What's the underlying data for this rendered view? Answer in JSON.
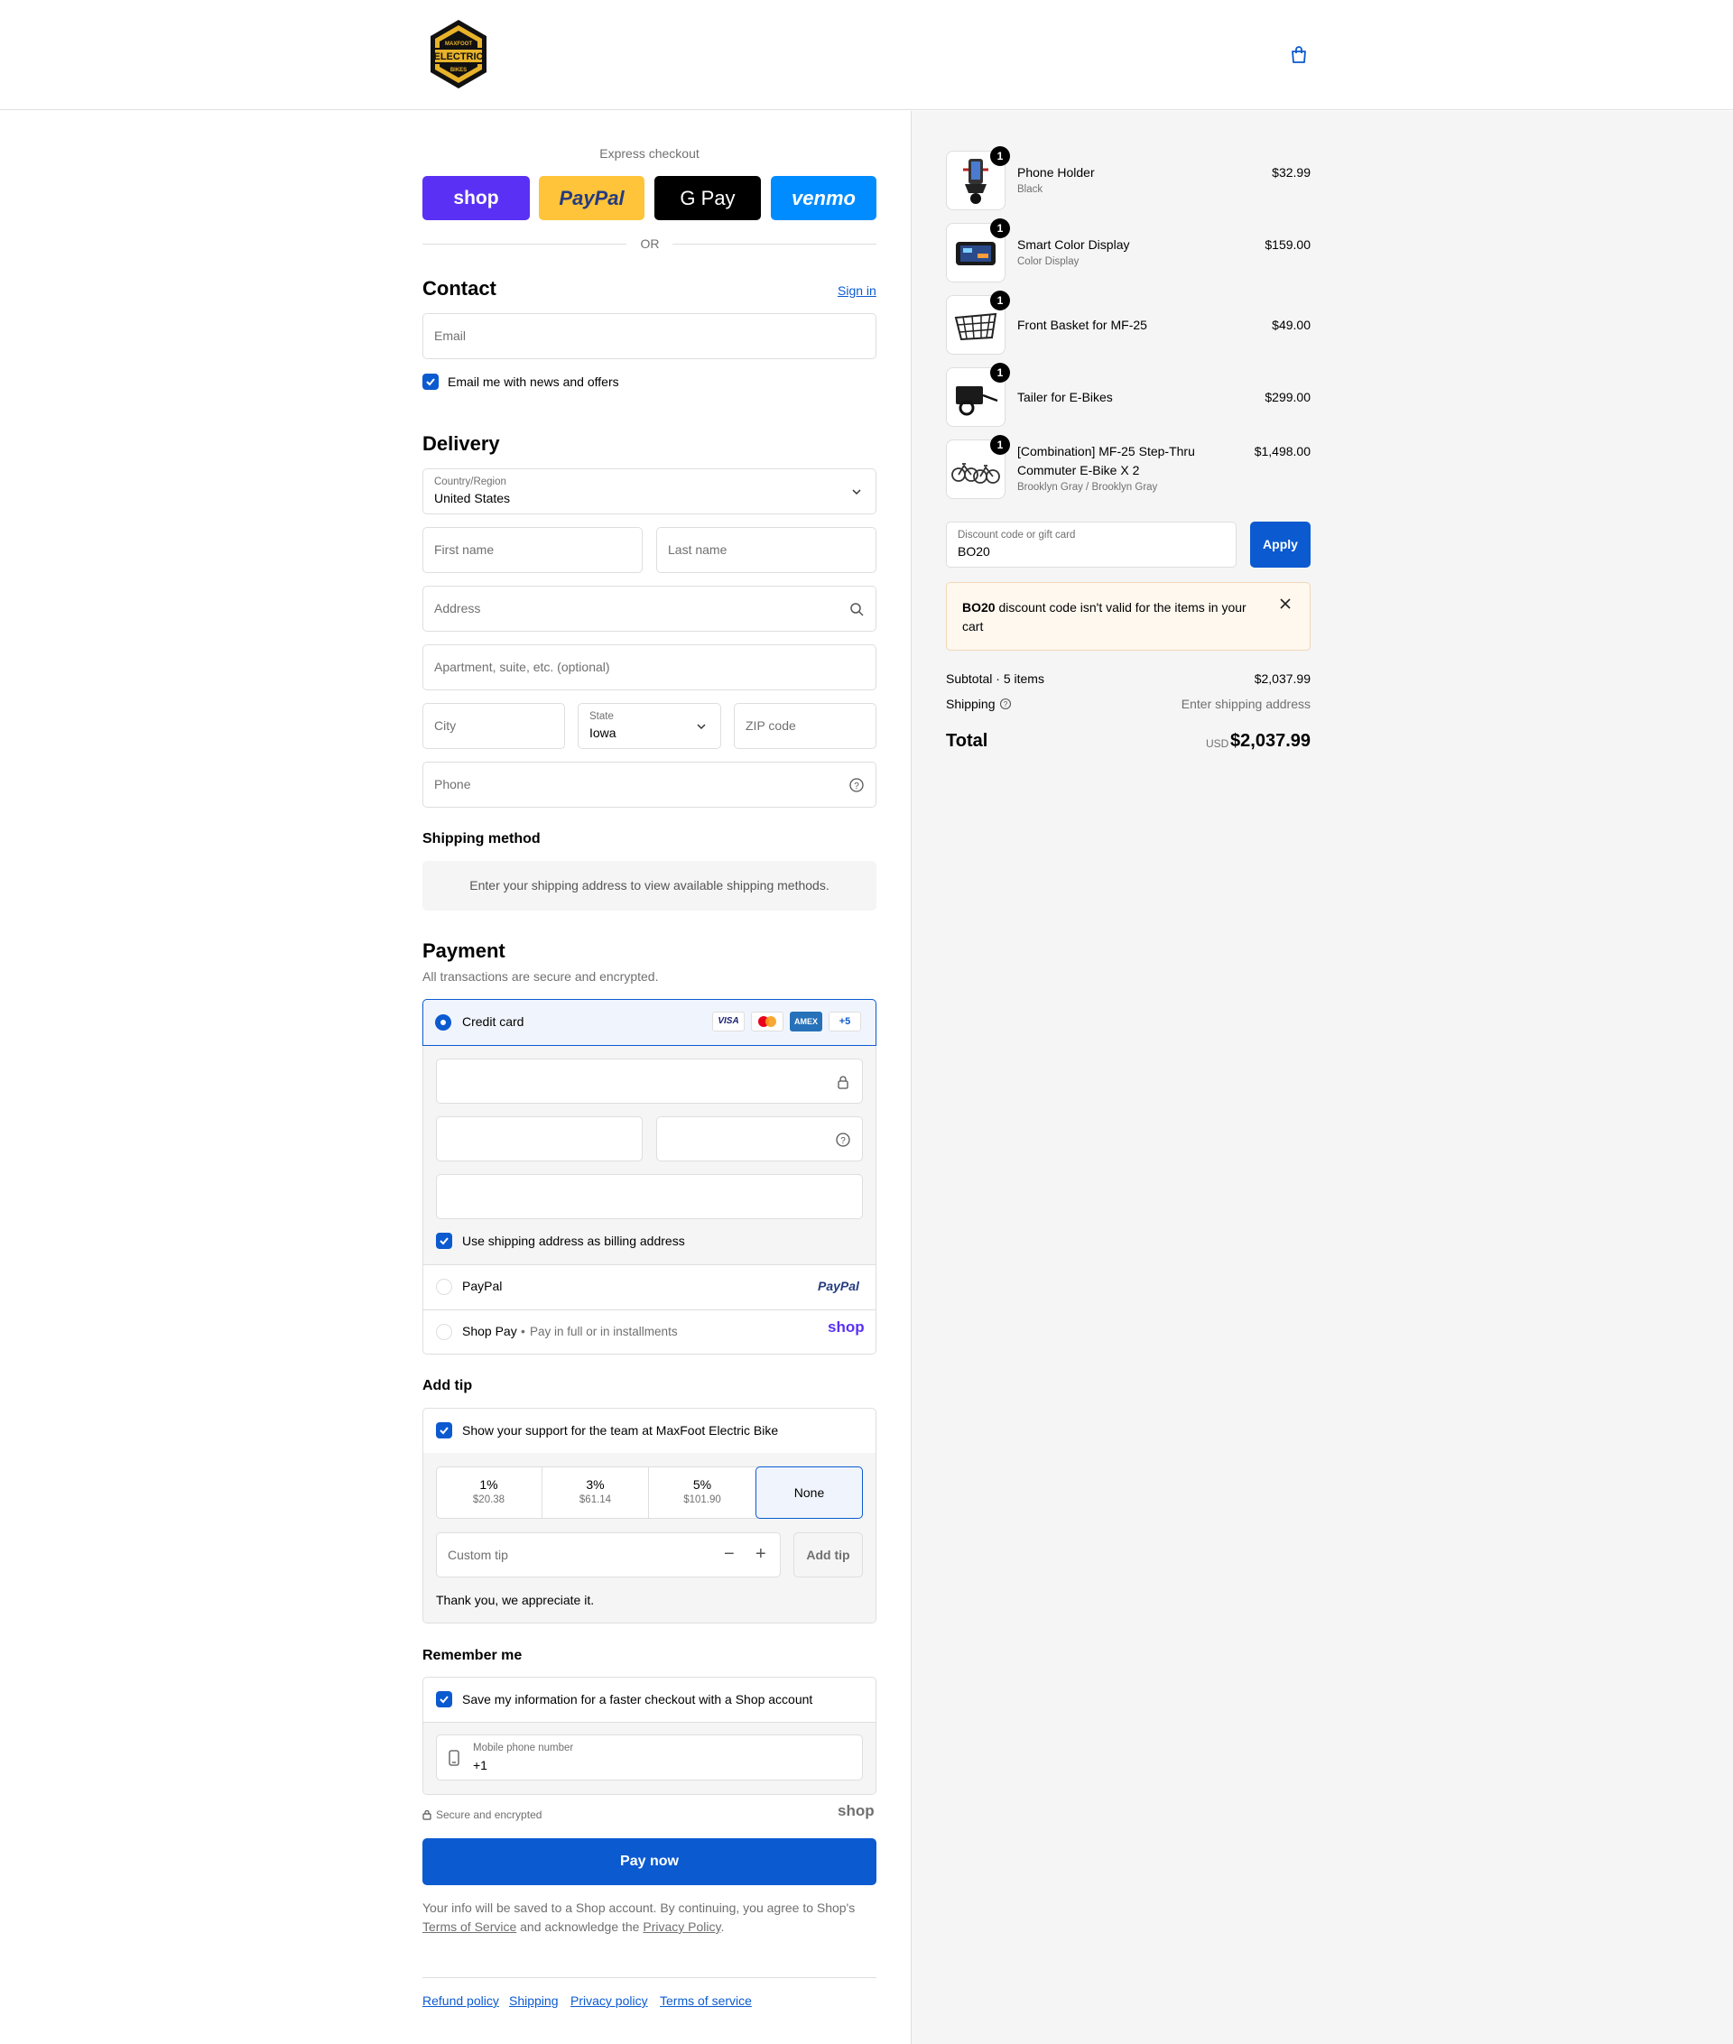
{
  "header": {
    "logo_text": "MAXFOOT ELECTRIC BIKES"
  },
  "express": {
    "title": "Express checkout",
    "shop_label": "shop",
    "paypal_label": "PayPal",
    "gpay_label": "G Pay",
    "venmo_label": "venmo",
    "or_label": "OR"
  },
  "contact": {
    "title": "Contact",
    "sign_in": "Sign in",
    "email_placeholder": "Email",
    "news_label": "Email me with news and offers"
  },
  "delivery": {
    "title": "Delivery",
    "country_label": "Country/Region",
    "country_value": "United States",
    "first_name": "First name",
    "last_name": "Last name",
    "address": "Address",
    "apartment": "Apartment, suite, etc. (optional)",
    "city": "City",
    "state_label": "State",
    "state_value": "Iowa",
    "zip": "ZIP code",
    "phone": "Phone"
  },
  "shipping_method": {
    "title": "Shipping method",
    "message": "Enter your shipping address to view available shipping methods."
  },
  "payment": {
    "title": "Payment",
    "subtitle": "All transactions are secure and encrypted.",
    "credit_card": "Credit card",
    "card_visa": "VISA",
    "card_amex": "AMEX",
    "card_more": "+5",
    "billing_label": "Use shipping address as billing address",
    "paypal": "PayPal",
    "paypal_logo": "PayPal",
    "shop_pay": "Shop Pay",
    "shop_pay_sub": "Pay in full or in installments",
    "shop_logo": "shop"
  },
  "tip": {
    "title": "Add tip",
    "support_label": "Show your support for the team at MaxFoot Electric Bike",
    "options": [
      {
        "pct": "1%",
        "amt": "$20.38"
      },
      {
        "pct": "3%",
        "amt": "$61.14"
      },
      {
        "pct": "5%",
        "amt": "$101.90"
      },
      {
        "pct": "None",
        "amt": ""
      }
    ],
    "custom_placeholder": "Custom tip",
    "add_tip": "Add tip",
    "thanks": "Thank you, we appreciate it."
  },
  "remember": {
    "title": "Remember me",
    "save_label": "Save my information for a faster checkout with a Shop account",
    "mobile_label": "Mobile phone number",
    "mobile_value": "+1",
    "secure_label": "Secure and encrypted",
    "shop_logo": "shop"
  },
  "pay_now": "Pay now",
  "legal": {
    "text1": "Your info will be saved to a Shop account. By continuing, you agree to Shop's",
    "terms": "Terms of Service",
    "text2": "and acknowledge the",
    "privacy": "Privacy Policy",
    "end": "."
  },
  "footer": {
    "refund": "Refund policy",
    "shipping": "Shipping",
    "privacy": "Privacy policy",
    "terms": "Terms of service"
  },
  "cart": {
    "items": [
      {
        "qty": "1",
        "name": "Phone Holder",
        "variant": "Black",
        "price": "$32.99"
      },
      {
        "qty": "1",
        "name": "Smart Color Display",
        "variant": "Color Display",
        "price": "$159.00"
      },
      {
        "qty": "1",
        "name": "Front Basket for MF-25",
        "variant": "",
        "price": "$49.00"
      },
      {
        "qty": "1",
        "name": "Tailer for E-Bikes",
        "variant": "",
        "price": "$299.00"
      },
      {
        "qty": "1",
        "name_line1": "[Combination] MF-25 Step-Thru",
        "name_line2": "Commuter E-Bike X 2",
        "variant": "Brooklyn Gray / Brooklyn Gray",
        "price": "$1,498.00"
      }
    ],
    "discount_label": "Discount code or gift card",
    "discount_value": "BO20",
    "apply": "Apply",
    "error_code": "BO20",
    "error_text_line1": " discount code isn't valid for the items in your",
    "error_text_line2": "cart",
    "subtotal_label": "Subtotal · 5 items",
    "subtotal_value": "$2,037.99",
    "shipping_label": "Shipping",
    "shipping_value": "Enter shipping address",
    "total_label": "Total",
    "total_currency": "USD",
    "total_value": "$2,037.99"
  },
  "colors": {
    "accent": "#0b5ad0",
    "shop_purple": "#5a31f4",
    "paypal_yellow": "#ffc439",
    "venmo_blue": "#008cff",
    "error_bg": "#fff8ef"
  }
}
